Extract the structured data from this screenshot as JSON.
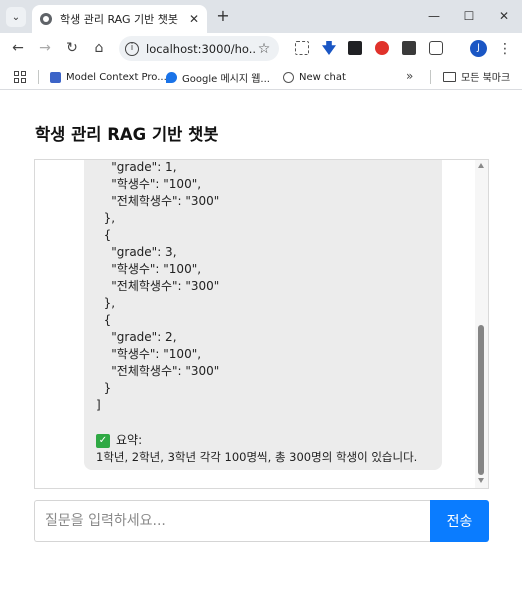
{
  "browser": {
    "tab_title": "학생 관리 RAG 기반 챗봇",
    "new_tab_glyph": "+",
    "tab_close_glyph": "✕",
    "url": "localhost:3000/ho...",
    "profile_initial": "J",
    "window_controls": {
      "minimize": "—",
      "maximize": "☐",
      "close": "✕"
    }
  },
  "bookmarks": {
    "items": [
      {
        "label": "Model Context Pro...",
        "icon": "model-context-protocol-icon",
        "color": "#3c64c8"
      },
      {
        "label": "Google 메시지 웹...",
        "icon": "google-messages-icon",
        "color": "#1a73e8"
      },
      {
        "label": "New chat",
        "icon": "chat-gear-icon",
        "color": "#555555"
      }
    ],
    "more_glyph": "»",
    "folder_label": "모든 북마크"
  },
  "page": {
    "title": "학생 관리 RAG 기반 챗봇"
  },
  "chat": {
    "code_lines": [
      "    \"grade\": 1,",
      "    \"학생수\": \"100\",",
      "    \"전체학생수\": \"300\"",
      "  },",
      "  {",
      "    \"grade\": 3,",
      "    \"학생수\": \"100\",",
      "    \"전체학생수\": \"300\"",
      "  },",
      "  {",
      "    \"grade\": 2,",
      "    \"학생수\": \"100\",",
      "    \"전체학생수\": \"300\"",
      "  }",
      "]"
    ],
    "summary_label": "요약:",
    "summary_text": "1학년, 2학년, 3학년 각각 100명씩, 총 300명의 학생이 있습니다."
  },
  "input": {
    "placeholder": "질문을 입력하세요...",
    "value": "",
    "send_label": "전송"
  },
  "colors": {
    "send_button": "#0a7cff",
    "bubble_bg": "#ececec",
    "check_icon": "#2fa944"
  }
}
